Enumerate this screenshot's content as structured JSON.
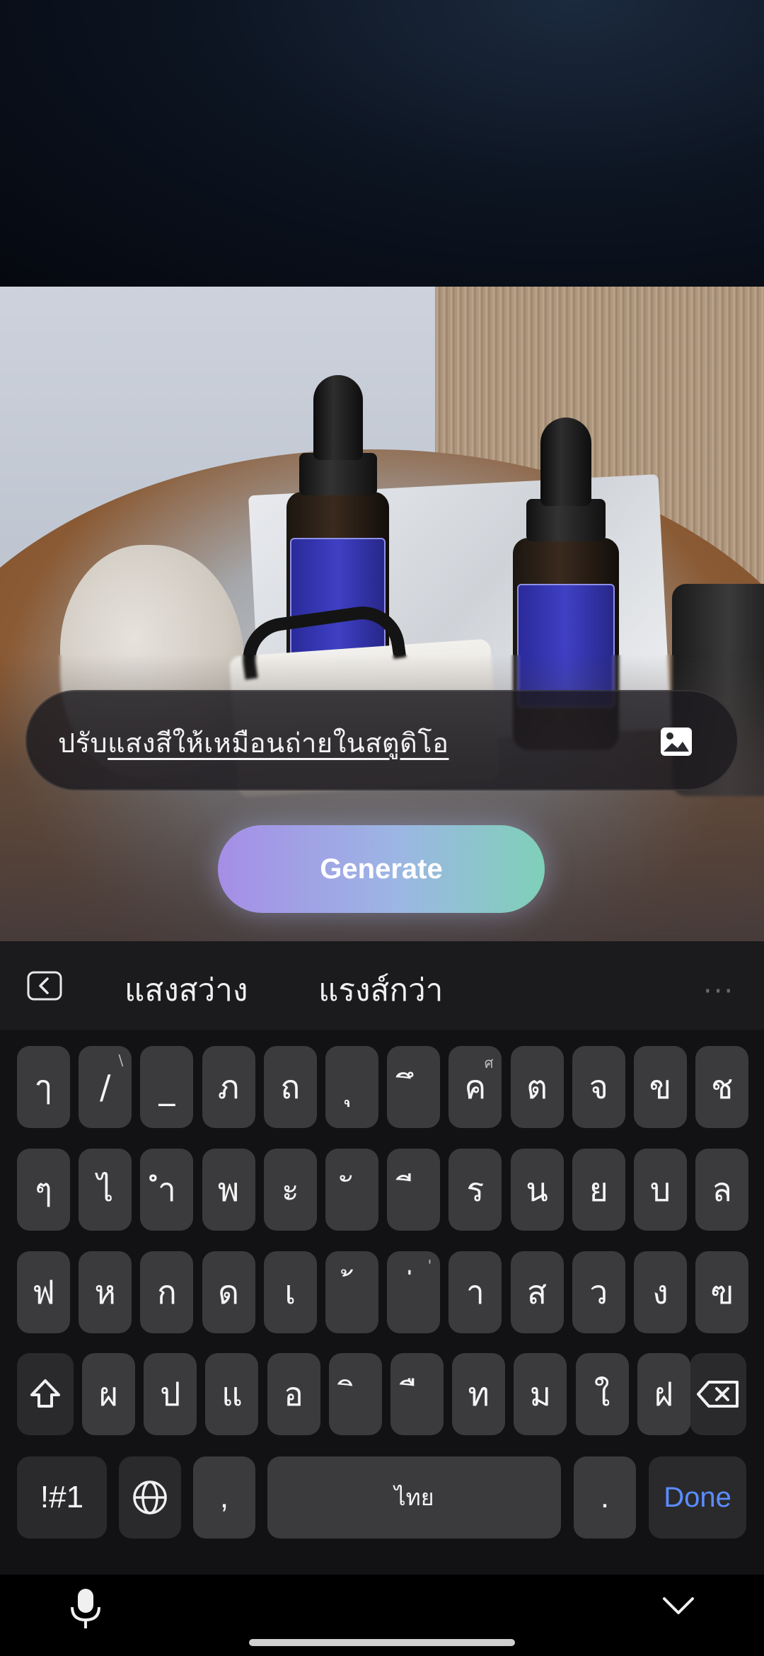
{
  "prompt": {
    "prefix": "ปรับ",
    "underlined": "แสงสีให้เหมือนถ่ายในสตูดิโอ",
    "image_icon": "image-icon"
  },
  "generate": {
    "label": "Generate"
  },
  "suggestions": {
    "back_icon": "chevron-left-icon",
    "words": [
      "แสงสว่าง",
      "แรงส์กว่า"
    ],
    "more": "···"
  },
  "keyboard": {
    "row1": [
      {
        "k": "ๅ"
      },
      {
        "k": "/",
        "h": "\\"
      },
      {
        "k": "_"
      },
      {
        "k": "ภ"
      },
      {
        "k": "ถ"
      },
      {
        "k": "ุ"
      },
      {
        "k": "ึ"
      },
      {
        "k": "ค",
        "h": "ศ"
      },
      {
        "k": "ต"
      },
      {
        "k": "จ"
      },
      {
        "k": "ข"
      },
      {
        "k": "ช"
      }
    ],
    "row2": [
      {
        "k": "ๆ"
      },
      {
        "k": "ไ"
      },
      {
        "k": "ำ"
      },
      {
        "k": "พ"
      },
      {
        "k": "ะ"
      },
      {
        "k": "ั"
      },
      {
        "k": "ี"
      },
      {
        "k": "ร"
      },
      {
        "k": "น"
      },
      {
        "k": "ย"
      },
      {
        "k": "บ"
      },
      {
        "k": "ล"
      }
    ],
    "row3": [
      {
        "k": "ฟ"
      },
      {
        "k": "ห"
      },
      {
        "k": "ก"
      },
      {
        "k": "ด"
      },
      {
        "k": "เ"
      },
      {
        "k": "้"
      },
      {
        "k": "่",
        "h": "'"
      },
      {
        "k": "า"
      },
      {
        "k": "ส"
      },
      {
        "k": "ว"
      },
      {
        "k": "ง"
      },
      {
        "k": "ฃ"
      }
    ],
    "row4": [
      {
        "k": "ผ"
      },
      {
        "k": "ป"
      },
      {
        "k": "แ"
      },
      {
        "k": "อ"
      },
      {
        "k": "ิ"
      },
      {
        "k": "ื"
      },
      {
        "k": "ท"
      },
      {
        "k": "ม"
      },
      {
        "k": "ใ"
      },
      {
        "k": "ฝ"
      }
    ],
    "shift_icon": "shift-icon",
    "backspace_icon": "backspace-icon",
    "symbols_label": "!#1",
    "globe_icon": "globe-icon",
    "comma": ",",
    "space_label": "ไทย",
    "period": ".",
    "done_label": "Done",
    "done_color": "#5a8dff"
  },
  "nav": {
    "mic_icon": "microphone-icon",
    "hide_icon": "chevron-down-icon"
  }
}
